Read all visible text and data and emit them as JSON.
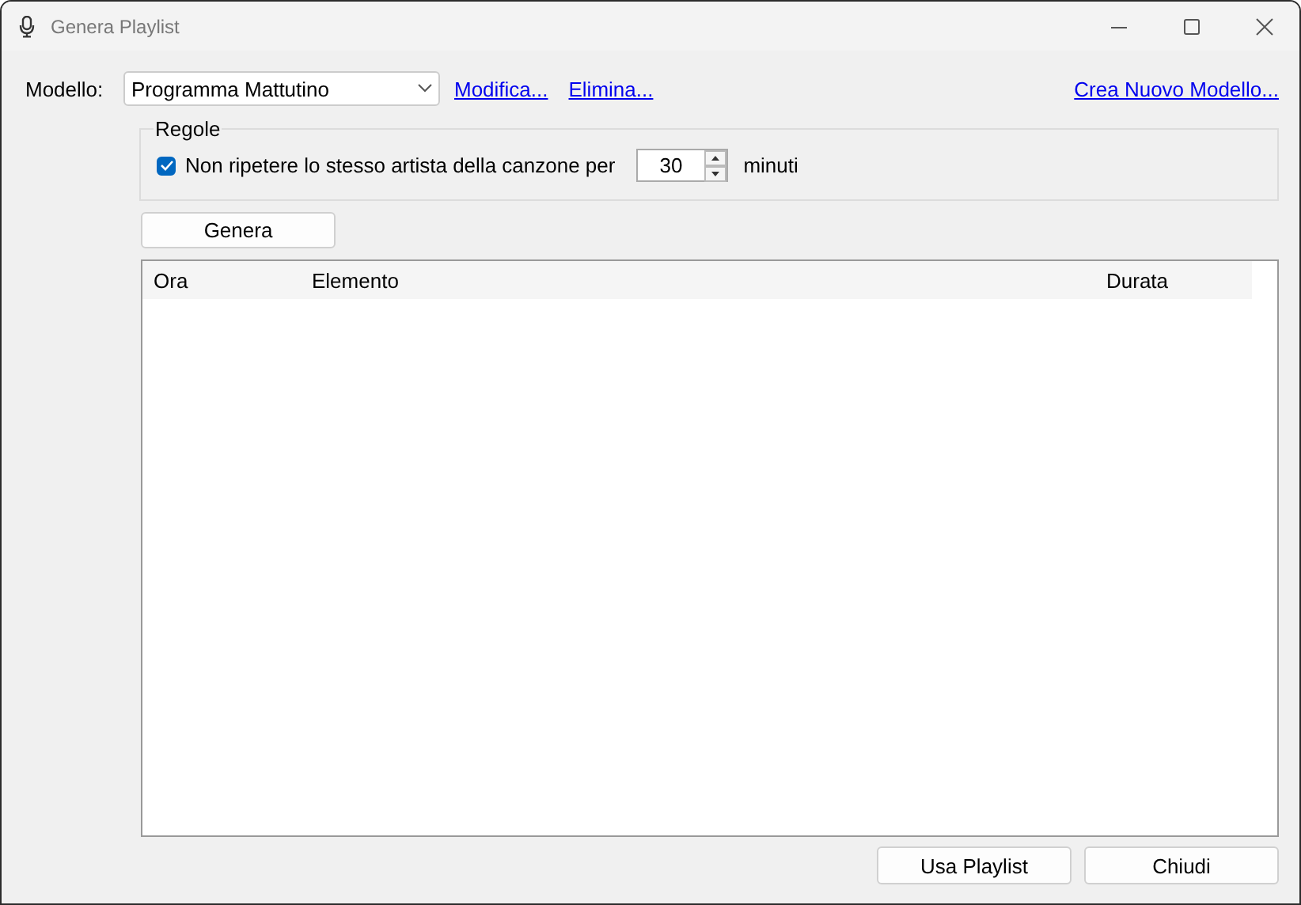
{
  "window": {
    "title": "Genera Playlist"
  },
  "template": {
    "label": "Modello:",
    "value": "Programma Mattutino",
    "links": [
      "Modifica...",
      "Elimina..."
    ],
    "new_link": "Crea Nuovo Modello..."
  },
  "rules": {
    "title": "Regole",
    "checkbox": {
      "label": "Non ripetere lo stesso artista della canzone per",
      "checked": true
    },
    "spinner": {
      "value": "30"
    },
    "unit": "minuti"
  },
  "generate_button": "Genera",
  "table": {
    "columns": [
      "Ora",
      "Elemento",
      "Durata"
    ]
  },
  "buttons": [
    "Usa Playlist",
    "Chiudi"
  ]
}
